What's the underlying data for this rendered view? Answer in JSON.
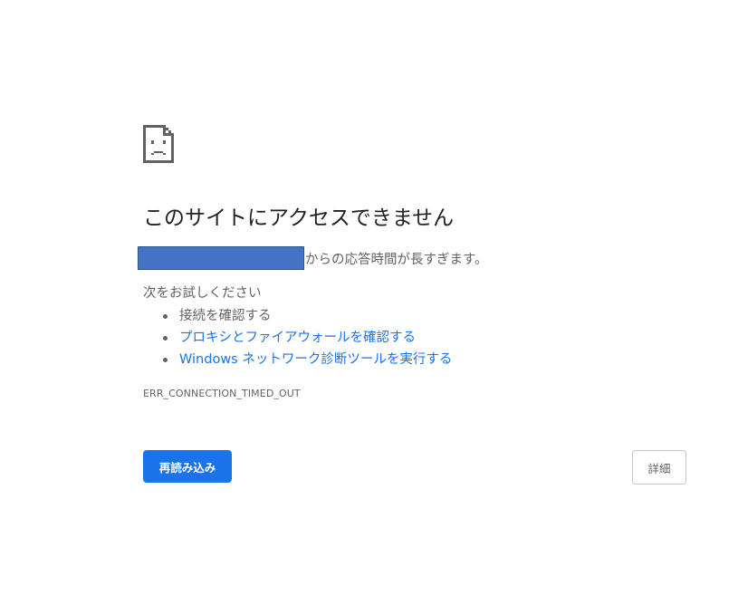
{
  "icon": "sad-page-icon",
  "title": "このサイトにアクセスできません",
  "message": {
    "host_redacted": true,
    "text": "からの応答時間が長すぎます。"
  },
  "suggestions": {
    "heading": "次をお試しください",
    "items": [
      {
        "label": "接続を確認する",
        "link": false
      },
      {
        "label": "プロキシとファイアウォールを確認する",
        "link": true
      },
      {
        "label": "Windows ネットワーク診断ツールを実行する",
        "link": true
      }
    ]
  },
  "error_code": "ERR_CONNECTION_TIMED_OUT",
  "buttons": {
    "reload_label": "再読み込み",
    "details_label": "詳細"
  },
  "colors": {
    "primary": "#1a73e8",
    "text": "#5f6368",
    "title": "#202124",
    "redaction": "#4472c4"
  }
}
